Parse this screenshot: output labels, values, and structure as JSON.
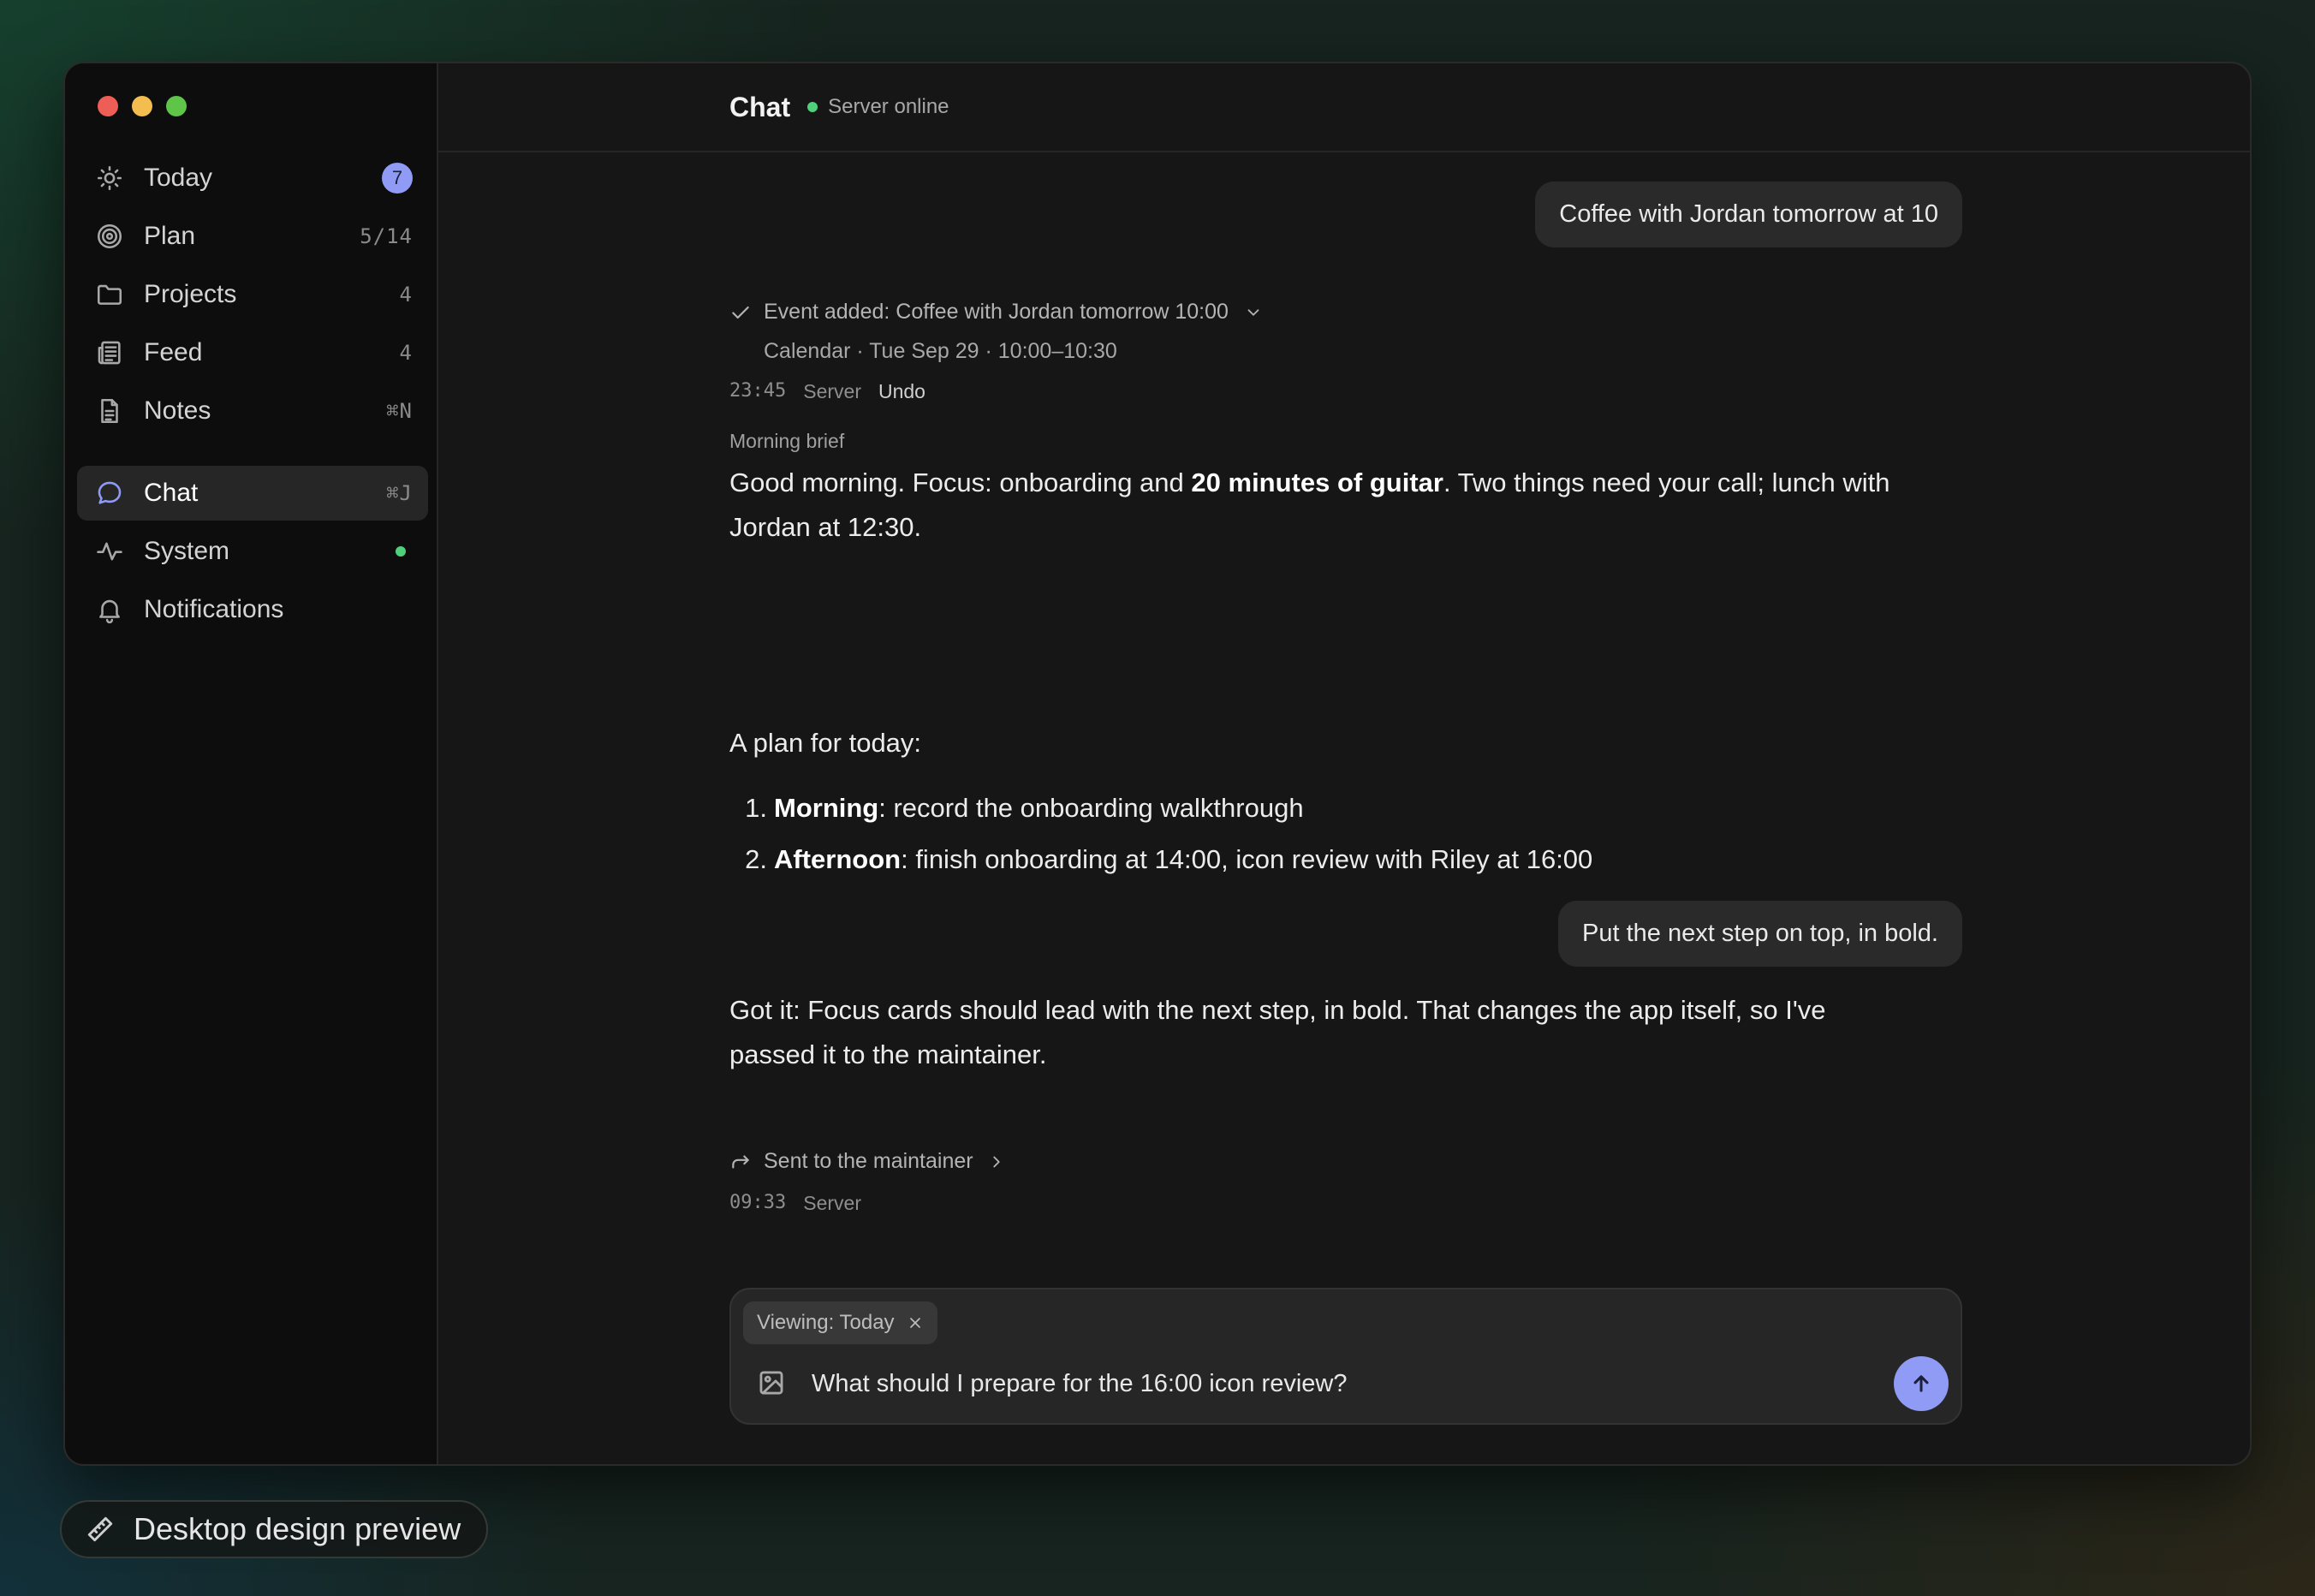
{
  "window": {
    "title": "Chat",
    "status": "Server online"
  },
  "sidebar": {
    "items": [
      {
        "label": "Today",
        "icon": "sun-icon",
        "badge": "7"
      },
      {
        "label": "Plan",
        "icon": "target-icon",
        "meta": "5/14"
      },
      {
        "label": "Projects",
        "icon": "folder-icon",
        "meta": "4"
      },
      {
        "label": "Feed",
        "icon": "newspaper-icon",
        "meta": "4"
      },
      {
        "label": "Notes",
        "icon": "document-icon",
        "meta": "⌘N"
      },
      {
        "label": "Chat",
        "icon": "chat-bubble-icon",
        "meta": "⌘J",
        "active": true
      },
      {
        "label": "System",
        "icon": "activity-icon",
        "status": "online"
      },
      {
        "label": "Notifications",
        "icon": "bell-icon"
      }
    ]
  },
  "messages": {
    "user1": "Coffee with Jordan tomorrow at 10",
    "event": {
      "title": "Event added: Coffee with Jordan tomorrow 10:00",
      "detail": "Calendar · Tue Sep 29 · 10:00–10:30",
      "time": "23:45",
      "source": "Server",
      "action": "Undo"
    },
    "brief": {
      "label": "Morning brief",
      "p1_a": "Good morning. Focus: onboarding and ",
      "p1_bold": "20 minutes of guitar",
      "p1_b": ". Two things need your call; lunch with Jordan at 12:30.",
      "plan_intro": "A plan for today:",
      "plan": [
        {
          "num": "1.",
          "bold": "Morning",
          "text": ": record the onboarding walkthrough"
        },
        {
          "num": "2.",
          "bold": "Afternoon",
          "text": ": finish onboarding at 14:00, icon review with Riley at 16:00"
        }
      ]
    },
    "user2": "Put the next step on top, in bold.",
    "reply": "Got it: Focus cards should lead with the next step, in bold. That changes the app itself, so I've passed it to the maintainer.",
    "handoff": {
      "title": "Sent to the maintainer",
      "time": "09:33",
      "source": "Server"
    }
  },
  "composer": {
    "chip": "Viewing: Today",
    "value": "What should I prepare for the 16:00 icon review?"
  },
  "footer": {
    "preview_label": "Desktop design preview"
  },
  "colors": {
    "accent": "#8f9bf5",
    "online": "#4fd07a",
    "background": "#161616"
  }
}
